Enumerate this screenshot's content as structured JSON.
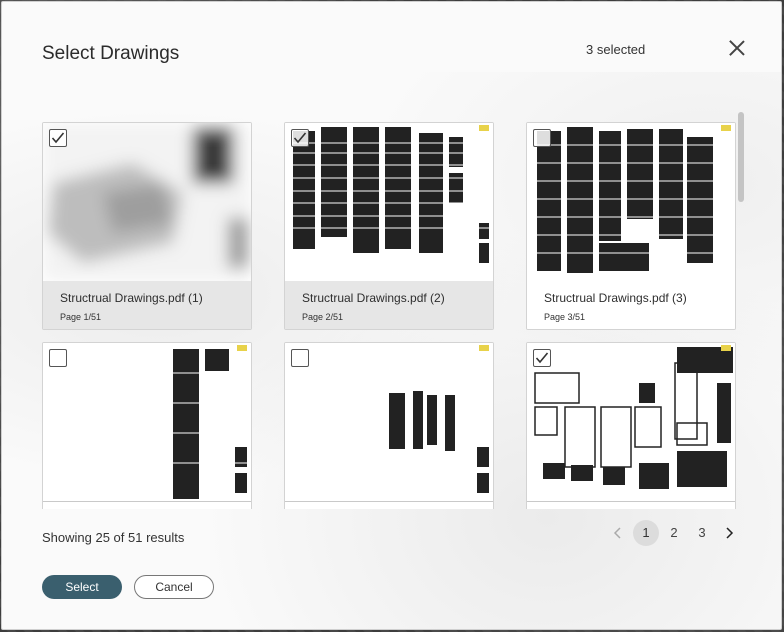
{
  "dialog": {
    "title": "Select Drawings",
    "selected_count": "3 selected"
  },
  "cards": [
    {
      "title": "Structrual Drawings.pdf (1)",
      "page": "Page 1/51",
      "checked": true
    },
    {
      "title": "Structrual Drawings.pdf (2)",
      "page": "Page 2/51",
      "checked": true
    },
    {
      "title": "Structrual Drawings.pdf (3)",
      "page": "Page 3/51",
      "checked": false
    },
    {
      "title": "",
      "page": "",
      "checked": false
    },
    {
      "title": "",
      "page": "",
      "checked": false
    },
    {
      "title": "",
      "page": "",
      "checked": true
    }
  ],
  "footer": {
    "results_text": "Showing 25 of 51 results",
    "pages": [
      "1",
      "2",
      "3"
    ],
    "active_page": "1",
    "select_label": "Select",
    "cancel_label": "Cancel"
  },
  "icons": {
    "close": "close-icon",
    "prev": "chevron-left-icon",
    "next": "chevron-right-icon",
    "check": "checkmark-icon"
  },
  "colors": {
    "primary_button": "#3a5f6e",
    "active_page_bg": "#dcdcdc"
  }
}
